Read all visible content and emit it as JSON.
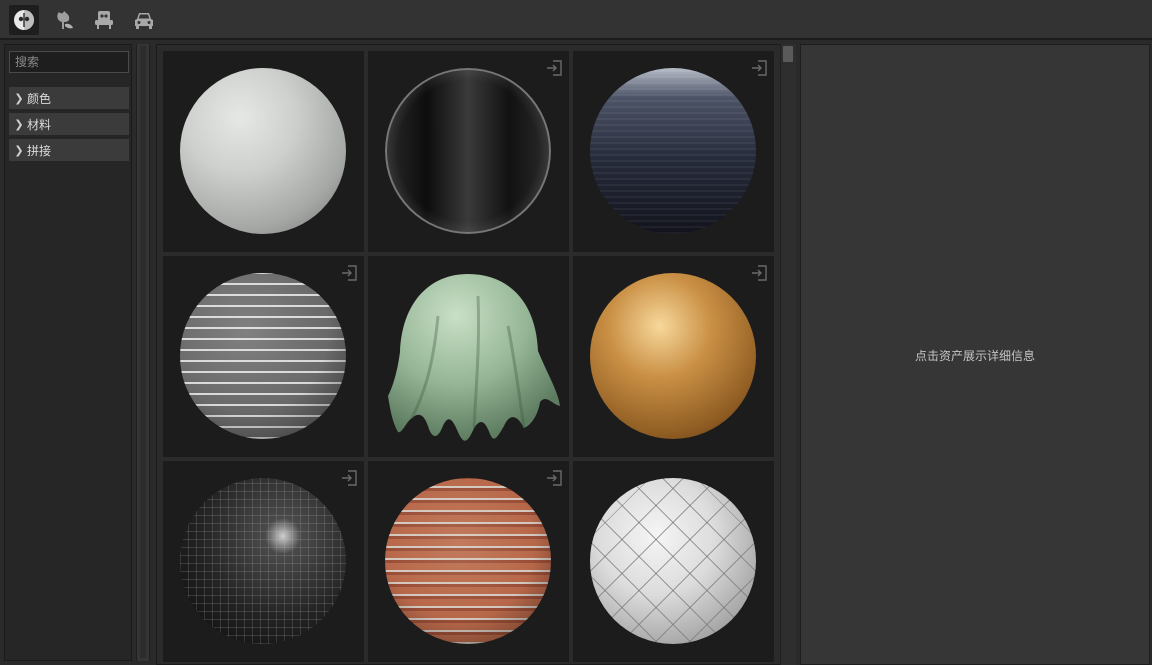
{
  "toolbar": {
    "tools": [
      {
        "icon": "material-sphere-icon",
        "active": true
      },
      {
        "icon": "plant-icon",
        "active": false
      },
      {
        "icon": "furniture-icon",
        "active": false
      },
      {
        "icon": "car-icon",
        "active": false
      }
    ]
  },
  "sidebar": {
    "search_placeholder": "搜索",
    "categories": [
      {
        "label": "颜色"
      },
      {
        "label": "材料"
      },
      {
        "label": "拼接"
      }
    ]
  },
  "assets": [
    {
      "material": "plaster",
      "has_import": false
    },
    {
      "material": "glass",
      "has_import": true
    },
    {
      "material": "water",
      "has_import": true
    },
    {
      "material": "brick",
      "has_import": true
    },
    {
      "material": "cloth",
      "has_import": false
    },
    {
      "material": "wood-tile",
      "has_import": true
    },
    {
      "material": "black-tile",
      "has_import": true
    },
    {
      "material": "red-brick",
      "has_import": true
    },
    {
      "material": "diamond-tile",
      "has_import": false
    }
  ],
  "detail": {
    "hint": "点击资产展示详细信息"
  },
  "colors": {
    "background": "#2a2a2a",
    "tile": "#1c1c1c",
    "panel": "#363636",
    "category": "#3b3b3b"
  }
}
